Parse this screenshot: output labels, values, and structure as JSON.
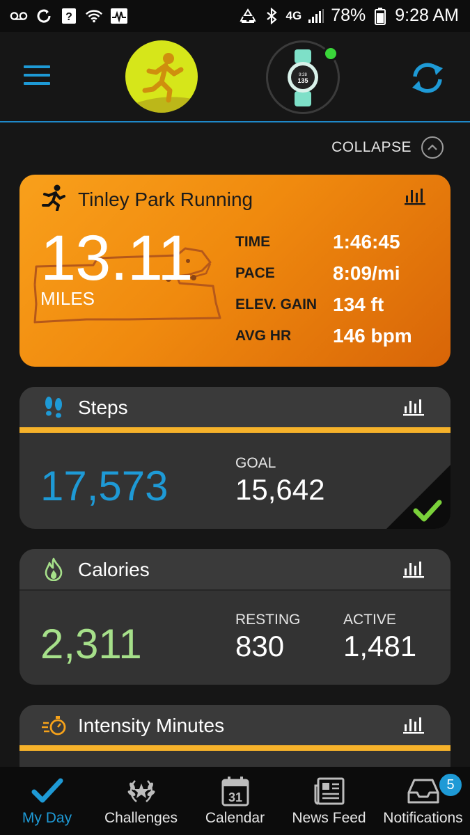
{
  "status_bar": {
    "battery": "78%",
    "time": "9:28 AM",
    "network": "4G",
    "icons": [
      "voicemail-icon",
      "sync-status-icon",
      "help-icon",
      "wifi-icon",
      "activity-icon",
      "recycle-icon",
      "bluetooth-icon",
      "signal-icon",
      "battery-icon"
    ]
  },
  "header": {
    "menu_icon": "hamburger-menu-icon",
    "profile_icon": "runner-avatar-icon",
    "device_icon": "watch-device-icon",
    "device_face_value": "135",
    "sync_icon": "sync-icon",
    "accent_color": "#1e9ad6"
  },
  "collapse": {
    "label": "COLLAPSE"
  },
  "run": {
    "title": "Tinley Park Running",
    "distance": "13.11",
    "unit": "MILES",
    "stats": [
      {
        "label": "TIME",
        "value": "1:46:45"
      },
      {
        "label": "PACE",
        "value": "8:09/mi"
      },
      {
        "label": "ELEV. GAIN",
        "value": "134 ft"
      },
      {
        "label": "AVG HR",
        "value": "146 bpm"
      }
    ],
    "gradient_start": "#f9a01b",
    "gradient_end": "#d86508"
  },
  "steps": {
    "title": "Steps",
    "value": "17,573",
    "goal_label": "GOAL",
    "goal_value": "15,642",
    "goal_met": true,
    "value_color": "#1e9ad6",
    "bar_color": "#f6b22a"
  },
  "calories": {
    "title": "Calories",
    "total": "2,311",
    "resting_label": "RESTING",
    "resting_value": "830",
    "active_label": "ACTIVE",
    "active_value": "1,481",
    "value_color": "#a6e08a"
  },
  "intensity": {
    "title": "Intensity Minutes"
  },
  "nav": {
    "items": [
      {
        "label": "My Day",
        "icon": "checkmark-icon",
        "active": true
      },
      {
        "label": "Challenges",
        "icon": "laurel-icon",
        "active": false
      },
      {
        "label": "Calendar",
        "icon": "calendar-icon",
        "day": "31",
        "active": false
      },
      {
        "label": "News Feed",
        "icon": "newspaper-icon",
        "active": false
      },
      {
        "label": "Notifications",
        "icon": "inbox-icon",
        "badge": "5",
        "active": false
      }
    ]
  }
}
